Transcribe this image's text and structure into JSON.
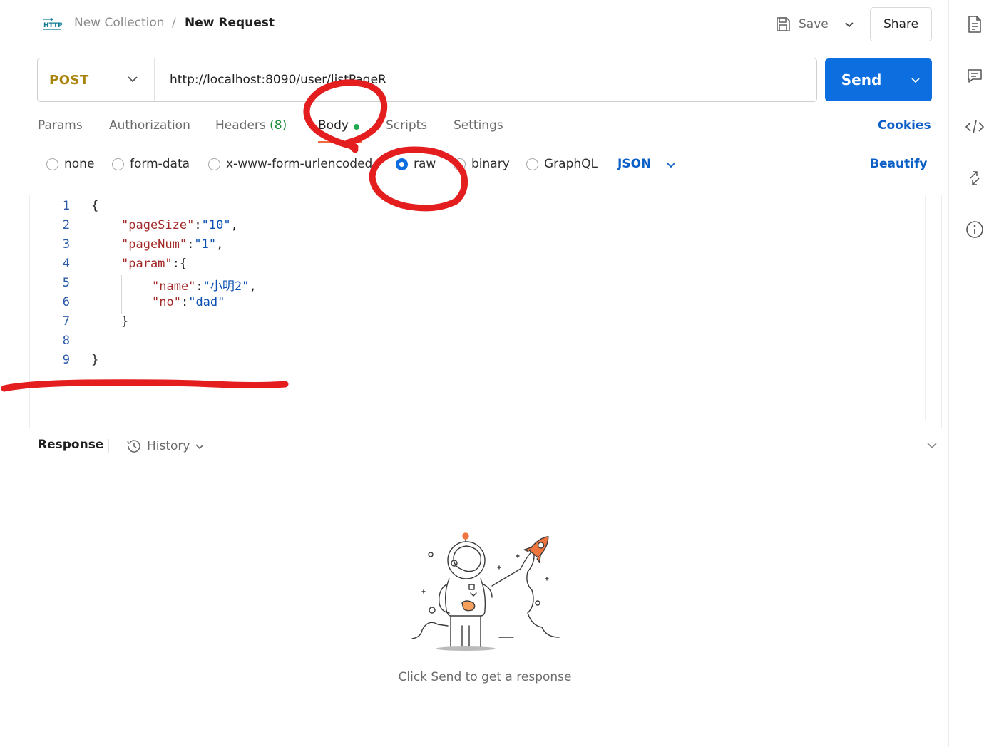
{
  "header": {
    "collection": "New Collection",
    "separator": "/",
    "request_name": "New Request",
    "save_label": "Save",
    "share_label": "Share"
  },
  "request": {
    "method": "POST",
    "url": "http://localhost:8090/user/listPageR",
    "send_label": "Send"
  },
  "tabs": [
    {
      "label": "Params"
    },
    {
      "label": "Authorization"
    },
    {
      "label": "Headers",
      "count": "(8)"
    },
    {
      "label": "Body"
    },
    {
      "label": "Scripts"
    },
    {
      "label": "Settings"
    }
  ],
  "cookies_label": "Cookies",
  "body_types": [
    {
      "label": "none",
      "selected": false
    },
    {
      "label": "form-data",
      "selected": false
    },
    {
      "label": "x-www-form-urlencoded",
      "selected": false
    },
    {
      "label": "raw",
      "selected": true
    },
    {
      "label": "binary",
      "selected": false
    },
    {
      "label": "GraphQL",
      "selected": false
    }
  ],
  "raw_format": "JSON",
  "beautify_label": "Beautify",
  "editor": {
    "line_numbers": [
      "1",
      "2",
      "3",
      "4",
      "5",
      "6",
      "7",
      "8",
      "9"
    ],
    "lines": [
      {
        "segments": [
          {
            "text": "{",
            "kind": "p"
          }
        ]
      },
      {
        "segments": [
          {
            "text": "\"pageSize\"",
            "kind": "k"
          },
          {
            "text": ":",
            "kind": "p"
          },
          {
            "text": "\"10\"",
            "kind": "s"
          },
          {
            "text": ",",
            "kind": "p"
          }
        ]
      },
      {
        "segments": [
          {
            "text": "\"pageNum\"",
            "kind": "k"
          },
          {
            "text": ":",
            "kind": "p"
          },
          {
            "text": "\"1\"",
            "kind": "s"
          },
          {
            "text": ",",
            "kind": "p"
          }
        ]
      },
      {
        "segments": [
          {
            "text": "\"param\"",
            "kind": "k"
          },
          {
            "text": ":{",
            "kind": "p"
          }
        ]
      },
      {
        "segments": [
          {
            "text": "\"name\"",
            "kind": "k"
          },
          {
            "text": ":",
            "kind": "p"
          },
          {
            "text": "\"小明2\"",
            "kind": "s"
          },
          {
            "text": ",",
            "kind": "p"
          }
        ]
      },
      {
        "segments": [
          {
            "text": "\"no\"",
            "kind": "k"
          },
          {
            "text": ":",
            "kind": "p"
          },
          {
            "text": "\"dad\"",
            "kind": "s"
          }
        ]
      },
      {
        "segments": [
          {
            "text": "}",
            "kind": "p"
          }
        ]
      },
      {
        "segments": []
      },
      {
        "segments": [
          {
            "text": "}",
            "kind": "p"
          }
        ]
      }
    ]
  },
  "response": {
    "label": "Response",
    "history_label": "History",
    "empty_message": "Click Send to get a response"
  },
  "colors": {
    "accent": "#0d6ee0",
    "method": "#a8840b",
    "annotation": "#e41e1e",
    "key": "#a32828",
    "string": "#0b4fb3"
  },
  "right_bar_icons": [
    "document-icon",
    "comment-icon",
    "code-icon",
    "arrows-icon",
    "info-icon"
  ]
}
